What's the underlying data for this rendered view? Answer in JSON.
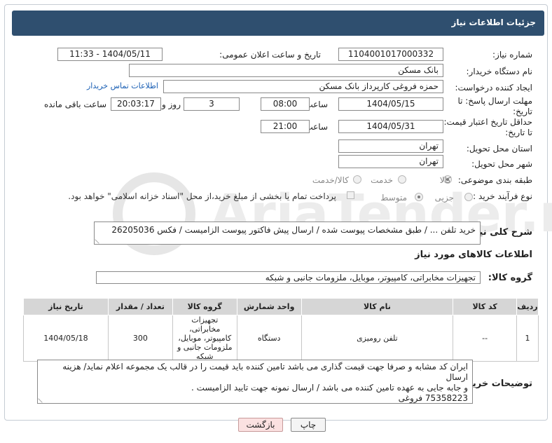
{
  "header": {
    "title": "جزئیات اطلاعات نیاز"
  },
  "fields": {
    "need_number_label": "شماره نیاز:",
    "need_number": "1104001017000332",
    "announce_label": "تاریخ و ساعت اعلان عمومی:",
    "announce_value": "1404/05/11 - 11:33",
    "buyer_label": "نام دستگاه خریدار:",
    "buyer_value": "بانک مسکن",
    "creator_label": "ایجاد کننده درخواست:",
    "creator_value": "حمزه فروغی کارپرداز بانک مسکن",
    "contact_link": "اطلاعات تماس خریدار",
    "deadline_label_1": "مهلت ارسال پاسخ: تا",
    "deadline_label_2": "تاریخ:",
    "deadline_date": "1404/05/15",
    "time_label": "ساعت",
    "deadline_time": "08:00",
    "days_value": "3",
    "days_label": "روز و",
    "remaining_value": "20:03:17",
    "remaining_label": "ساعت باقی مانده",
    "validity_label_1": "حداقل تاریخ اعتبار قیمت:",
    "validity_label_2": "تا تاریخ:",
    "validity_date": "1404/05/31",
    "validity_time": "21:00",
    "province_label": "استان محل تحویل:",
    "province_value": "تهران",
    "city_label": "شهر محل تحویل:",
    "city_value": "تهران",
    "category_label": "طبقه بندی موضوعی:",
    "category_options": [
      "کالا",
      "خدمت",
      "کالا/خدمت"
    ],
    "process_label": "نوع فرآیند خرید :",
    "process_options": [
      "جزیی",
      "متوسط"
    ],
    "payment_note": "پرداخت تمام یا بخشی از مبلغ خرید،از محل \"اسناد خزانه اسلامی\" خواهد بود."
  },
  "description": {
    "label": "شرح کلی نیاز:",
    "value": "خرید تلفن  ... / طبق مشخصات پیوست شده / ارسال پیش فاکتور پیوست الزامیست / فکس 26205036"
  },
  "goods": {
    "section_title": "اطلاعات کالاهای مورد نیاز",
    "group_label": "گروه کالا:",
    "group_value": "تجهیزات مخابراتی، کامپیوتر، موبایل، ملزومات جانبی و شبکه"
  },
  "table": {
    "headers": [
      "ردیف",
      "کد کالا",
      "نام کالا",
      "واحد شمارش",
      "گروه کالا",
      "تعداد / مقدار",
      "تاریخ نیاز"
    ],
    "rows": [
      [
        "1",
        "--",
        "تلفن رومیزی",
        "دستگاه",
        "تجهیزات مخابراتی، کامپیوتر، موبایل، ملزومات جانبی و شبکه",
        "300",
        "1404/05/18"
      ]
    ]
  },
  "buyer_notes": {
    "label": "توضیحات خریدار:",
    "line1": "ایران کد مشابه و صرفا جهت قیمت گذاری می باشد تامین کننده باید قیمت را در قالب یک مجموعه اعلام نماید/ هزینه ارسال",
    "line2": "و جابه جایی به عهده تامین کننده می باشد / ارسال نمونه جهت تایید الزامیست .",
    "line3": "75358223 فروغی"
  },
  "buttons": {
    "print": "چاپ",
    "back": "بازگشت"
  },
  "watermark": {
    "text": "AriaTender.net"
  }
}
